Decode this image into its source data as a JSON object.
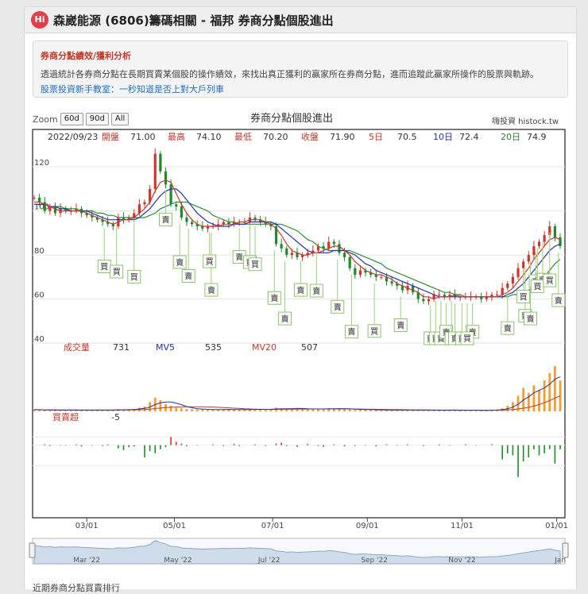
{
  "header": {
    "logo": "Hi",
    "title": "森崴能源 (6806)籌碼相關 - 福邦 券商分點個股進出"
  },
  "info": {
    "title": "券商分點績效/獲利分析",
    "desc": "透過統計各券商分點在長期買賣某個股的操作績效，來找出真正獲利的贏家所在券商分點，進而追蹤此贏家所操作的股票與軌跡。",
    "link": "股票投資新手教室：一秒知道是否上對大戶列車"
  },
  "zoom": {
    "label": "Zoom",
    "buttons": [
      "60d",
      "90d",
      "All"
    ]
  },
  "chart_title": "券商分點個股進出",
  "credit": "嗨投資 histock.tw",
  "ohlc_bar": {
    "date": "2022/09/23",
    "items": [
      {
        "label": "開盤",
        "value": "71.00",
        "color": "#c0392b"
      },
      {
        "label": "最高",
        "value": "74.10",
        "color": "#c0392b"
      },
      {
        "label": "最低",
        "value": "70.20",
        "color": "#c0392b"
      },
      {
        "label": "收盤",
        "value": "71.90",
        "color": "#c0392b"
      },
      {
        "label": "5日",
        "value": "70.5",
        "color": "#c0392b"
      },
      {
        "label": "10日",
        "value": "72.4",
        "color": "#2233aa"
      },
      {
        "label": "20日",
        "value": "74.9",
        "color": "#2e7d32"
      }
    ]
  },
  "volume_bar": {
    "items": [
      {
        "label": "成交量",
        "value": "731",
        "color": "#c0392b"
      },
      {
        "label": "MV5",
        "value": "535",
        "color": "#2233aa"
      },
      {
        "label": "MV20",
        "value": "507",
        "color": "#c0392b"
      }
    ]
  },
  "net_bar": {
    "label": "買賣超",
    "value": "-5"
  },
  "badges": {
    "buy": "買",
    "sell": "賣"
  },
  "footer_text": "近期券商分點買賣排行",
  "chart_data": {
    "type": "line",
    "price": {
      "ylim": [
        40,
        128
      ],
      "yticks": [
        40,
        60,
        80,
        100,
        120
      ],
      "x": [
        0,
        3,
        6,
        9,
        12,
        15,
        18,
        21,
        24,
        27,
        30,
        33,
        36,
        39,
        42,
        45,
        48,
        51,
        54,
        57,
        60,
        63,
        66,
        69,
        72,
        75,
        78,
        81,
        84,
        87,
        90,
        93,
        96,
        99,
        102,
        105,
        108,
        111,
        114,
        117,
        120,
        123,
        126,
        129,
        132,
        135,
        138,
        141,
        144,
        147,
        150,
        153,
        156,
        159,
        162,
        165,
        168,
        171,
        174,
        177,
        180,
        183,
        186,
        189,
        192,
        195,
        198,
        201,
        204,
        207,
        210,
        213,
        216,
        219,
        222,
        225,
        228,
        231,
        234,
        237,
        240,
        243,
        246,
        249,
        252,
        255,
        258,
        261,
        264,
        267,
        270,
        273,
        276,
        279,
        282,
        285,
        288,
        291,
        294,
        297,
        300
      ],
      "close": [
        106,
        104,
        100,
        102,
        99,
        101,
        100,
        100,
        101,
        99,
        98,
        97,
        96,
        95,
        94,
        93,
        97,
        96,
        97,
        99,
        103,
        104,
        110,
        126,
        118,
        112,
        103,
        102,
        97,
        95,
        94,
        93,
        92,
        93,
        93,
        94,
        95,
        94,
        95,
        95,
        95,
        97,
        96,
        95,
        94,
        93,
        85,
        83,
        80,
        81,
        79,
        80,
        81,
        82,
        84,
        83,
        86,
        85,
        81,
        79,
        74,
        71,
        73,
        72,
        71,
        70,
        70,
        68,
        67,
        66,
        64,
        66,
        63,
        60,
        59,
        60,
        62,
        62,
        61,
        62,
        61,
        61,
        61,
        61,
        61,
        60,
        61,
        62,
        62,
        65,
        67,
        70,
        74,
        77,
        80,
        84,
        86,
        89,
        93,
        88,
        84
      ],
      "ma5": [
        104,
        104,
        103,
        102,
        101,
        100,
        100,
        100,
        100,
        100,
        99,
        98,
        97,
        96,
        95,
        94,
        95,
        96,
        96,
        97,
        99,
        101,
        104,
        109,
        113,
        114,
        113,
        108,
        103,
        99,
        96,
        94,
        93,
        93,
        93,
        93,
        94,
        94,
        94,
        95,
        95,
        96,
        96,
        96,
        95,
        94,
        92,
        89,
        85,
        82,
        81,
        80,
        80,
        81,
        81,
        82,
        83,
        84,
        84,
        82,
        80,
        77,
        75,
        73,
        72,
        71,
        71,
        70,
        69,
        67,
        66,
        65,
        64,
        63,
        61,
        61,
        60,
        61,
        61,
        61,
        62,
        61,
        61,
        61,
        61,
        61,
        61,
        61,
        61,
        62,
        63,
        65,
        68,
        71,
        74,
        78,
        81,
        84,
        87,
        88,
        87
      ],
      "ma10": [
        103,
        103,
        103,
        102,
        102,
        101,
        101,
        100,
        100,
        100,
        100,
        99,
        98,
        97,
        96,
        96,
        96,
        96,
        96,
        96,
        97,
        99,
        101,
        104,
        107,
        109,
        110,
        110,
        108,
        105,
        102,
        99,
        97,
        95,
        94,
        93,
        93,
        93,
        94,
        94,
        94,
        95,
        95,
        95,
        95,
        95,
        94,
        92,
        90,
        88,
        86,
        84,
        82,
        81,
        81,
        81,
        81,
        82,
        82,
        82,
        81,
        80,
        78,
        76,
        75,
        73,
        72,
        71,
        70,
        69,
        68,
        67,
        66,
        65,
        64,
        63,
        62,
        61,
        61,
        61,
        61,
        61,
        61,
        61,
        61,
        61,
        61,
        61,
        61,
        61,
        62,
        63,
        65,
        67,
        70,
        73,
        76,
        79,
        82,
        84,
        85
      ],
      "ma20": [
        103,
        103,
        103,
        102,
        102,
        102,
        101,
        101,
        101,
        100,
        100,
        100,
        99,
        99,
        98,
        98,
        97,
        97,
        97,
        97,
        97,
        97,
        98,
        99,
        101,
        102,
        103,
        104,
        104,
        104,
        103,
        102,
        101,
        100,
        98,
        97,
        96,
        95,
        95,
        94,
        94,
        94,
        94,
        94,
        94,
        94,
        94,
        94,
        93,
        92,
        91,
        89,
        87,
        86,
        84,
        83,
        82,
        82,
        82,
        82,
        82,
        81,
        80,
        79,
        78,
        77,
        76,
        74,
        73,
        72,
        71,
        70,
        69,
        68,
        67,
        66,
        65,
        64,
        63,
        63,
        62,
        62,
        61,
        61,
        61,
        61,
        61,
        61,
        61,
        61,
        61,
        62,
        62,
        63,
        64,
        66,
        68,
        70,
        73,
        76,
        78
      ]
    },
    "volume": {
      "ylim": [
        0,
        900
      ],
      "x": [
        0,
        3,
        6,
        9,
        12,
        15,
        18,
        21,
        24,
        27,
        30,
        33,
        36,
        39,
        42,
        45,
        48,
        51,
        54,
        57,
        60,
        63,
        66,
        69,
        72,
        75,
        78,
        81,
        84,
        87,
        90,
        93,
        96,
        99,
        102,
        105,
        108,
        111,
        114,
        117,
        120,
        123,
        126,
        129,
        132,
        135,
        138,
        141,
        144,
        147,
        150,
        153,
        156,
        159,
        162,
        165,
        168,
        171,
        174,
        177,
        180,
        183,
        186,
        189,
        192,
        195,
        198,
        201,
        204,
        207,
        210,
        213,
        216,
        219,
        222,
        225,
        228,
        231,
        234,
        237,
        240,
        243,
        246,
        249,
        252,
        255,
        258,
        261,
        264,
        267,
        270,
        273,
        276,
        279,
        282,
        285,
        288,
        291,
        294,
        297,
        300
      ],
      "values": [
        30,
        25,
        20,
        22,
        20,
        18,
        20,
        25,
        18,
        20,
        22,
        18,
        20,
        22,
        25,
        20,
        35,
        30,
        25,
        40,
        60,
        80,
        150,
        220,
        180,
        120,
        90,
        60,
        50,
        40,
        35,
        30,
        30,
        28,
        25,
        30,
        35,
        30,
        28,
        30,
        25,
        30,
        40,
        35,
        30,
        25,
        60,
        50,
        40,
        45,
        40,
        35,
        30,
        35,
        45,
        40,
        50,
        45,
        40,
        35,
        30,
        25,
        30,
        28,
        25,
        20,
        22,
        20,
        18,
        20,
        22,
        25,
        20,
        18,
        15,
        18,
        22,
        20,
        18,
        20,
        18,
        15,
        18,
        20,
        18,
        15,
        18,
        22,
        30,
        50,
        90,
        150,
        250,
        380,
        300,
        420,
        350,
        500,
        620,
        731,
        500
      ],
      "mv5": [
        28,
        27,
        25,
        23,
        21,
        20,
        20,
        21,
        21,
        21,
        21,
        20,
        20,
        20,
        21,
        21,
        24,
        26,
        27,
        30,
        38,
        47,
        69,
        110,
        138,
        150,
        152,
        134,
        108,
        76,
        59,
        43,
        37,
        33,
        30,
        29,
        30,
        31,
        30,
        30,
        30,
        29,
        31,
        32,
        32,
        33,
        38,
        40,
        41,
        44,
        47,
        46,
        41,
        39,
        39,
        39,
        40,
        43,
        44,
        42,
        40,
        35,
        32,
        30,
        28,
        26,
        25,
        23,
        21,
        21,
        21,
        21,
        21,
        21,
        20,
        20,
        19,
        18,
        18,
        19,
        20,
        18,
        18,
        18,
        18,
        17,
        17,
        19,
        21,
        27,
        42,
        68,
        114,
        184,
        234,
        300,
        340,
        380,
        440,
        520,
        560
      ],
      "mv20": [
        26,
        26,
        25,
        25,
        24,
        23,
        22,
        22,
        22,
        21,
        21,
        21,
        21,
        21,
        21,
        21,
        22,
        22,
        23,
        24,
        27,
        30,
        36,
        45,
        53,
        60,
        65,
        69,
        72,
        74,
        75,
        75,
        74,
        72,
        70,
        66,
        62,
        57,
        52,
        48,
        43,
        38,
        36,
        34,
        32,
        31,
        32,
        33,
        34,
        35,
        36,
        37,
        37,
        38,
        38,
        39,
        40,
        40,
        41,
        41,
        40,
        38,
        37,
        35,
        34,
        33,
        32,
        31,
        30,
        28,
        27,
        26,
        25,
        24,
        23,
        22,
        21,
        21,
        20,
        20,
        20,
        20,
        19,
        19,
        19,
        19,
        18,
        18,
        19,
        21,
        25,
        30,
        38,
        50,
        65,
        85,
        110,
        140,
        175,
        215,
        250
      ]
    },
    "net_buy": {
      "ylim": [
        -100,
        40
      ],
      "x": [
        0,
        3,
        6,
        9,
        12,
        15,
        18,
        21,
        24,
        27,
        30,
        33,
        36,
        39,
        42,
        45,
        48,
        51,
        54,
        57,
        60,
        63,
        66,
        69,
        72,
        75,
        78,
        81,
        84,
        87,
        90,
        93,
        96,
        99,
        102,
        105,
        108,
        111,
        114,
        117,
        120,
        123,
        126,
        129,
        132,
        135,
        138,
        141,
        144,
        147,
        150,
        153,
        156,
        159,
        162,
        165,
        168,
        171,
        174,
        177,
        180,
        183,
        186,
        189,
        192,
        195,
        198,
        201,
        204,
        207,
        210,
        213,
        216,
        219,
        222,
        225,
        228,
        231,
        234,
        237,
        240,
        243,
        246,
        249,
        252,
        255,
        258,
        261,
        264,
        267,
        270,
        273,
        276,
        279,
        282,
        285,
        288,
        291,
        294,
        297,
        300
      ],
      "values": [
        0,
        0,
        2,
        -2,
        0,
        1,
        -1,
        0,
        2,
        -3,
        0,
        1,
        0,
        -2,
        2,
        0,
        -8,
        -12,
        -5,
        -3,
        0,
        -30,
        -15,
        -20,
        -10,
        -5,
        20,
        8,
        4,
        -3,
        0,
        1,
        0,
        0,
        2,
        0,
        -2,
        0,
        3,
        -2,
        0,
        0,
        2,
        0,
        -2,
        0,
        4,
        6,
        -2,
        0,
        -4,
        0,
        3,
        0,
        -2,
        -4,
        0,
        2,
        0,
        -3,
        0,
        -2,
        0,
        1,
        0,
        -3,
        0,
        2,
        0,
        -1,
        0,
        2,
        0,
        0,
        -2,
        0,
        0,
        2,
        0,
        -1,
        0,
        0,
        2,
        0,
        -1,
        0,
        0,
        2,
        0,
        -35,
        -20,
        -25,
        -78,
        -40,
        -30,
        -10,
        -25,
        -20,
        -10,
        -45,
        -10
      ]
    },
    "events": {
      "buy_x": [
        40,
        47,
        57,
        100,
        126,
        194,
        247,
        279,
        287,
        294
      ],
      "sell_x": [
        75,
        83,
        88,
        101,
        117,
        123,
        137,
        143,
        152,
        161,
        173,
        181,
        209,
        226,
        229,
        232,
        235,
        238,
        240,
        244,
        250,
        270,
        280,
        283,
        286,
        290,
        299
      ]
    },
    "xaxis": {
      "ticks": [
        {
          "x": 30,
          "label": "03/01"
        },
        {
          "x": 80,
          "label": "05/01"
        },
        {
          "x": 136,
          "label": "07/01"
        },
        {
          "x": 190,
          "label": "09/01"
        },
        {
          "x": 244,
          "label": "11/01"
        },
        {
          "x": 298,
          "label": "01/01"
        }
      ]
    },
    "navigator": {
      "labels": [
        {
          "x": 30,
          "label": "Mar '22"
        },
        {
          "x": 82,
          "label": "May '22"
        },
        {
          "x": 134,
          "label": "Jul '22"
        },
        {
          "x": 194,
          "label": "Sep '22"
        },
        {
          "x": 244,
          "label": "Nov '22"
        },
        {
          "x": 300,
          "label": "Jan"
        }
      ]
    }
  }
}
